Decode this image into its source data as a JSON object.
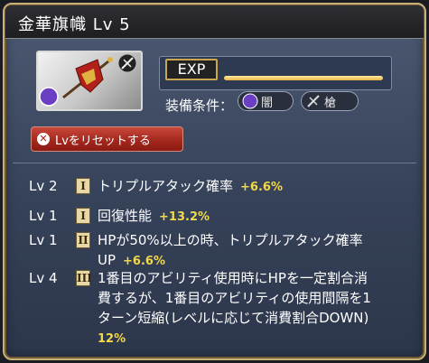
{
  "window": {
    "title": "金華旗幟 Lv 5"
  },
  "item": {
    "icon": "war-banner-icon",
    "element_badge": "dark-element-icon",
    "weapon_badge": "spear-icon"
  },
  "exp": {
    "label": "EXP",
    "progress": 1.0,
    "fill_color": "#f0c860"
  },
  "conditions": {
    "label": "装備条件：",
    "element": {
      "icon": "dark-element-icon",
      "text": "闇"
    },
    "weapon": {
      "icon": "spear-icon",
      "text": "槍"
    }
  },
  "reset_button": {
    "icon": "close-icon",
    "label": "Lvをリセットする"
  },
  "skills": [
    {
      "lv": "Lv 2",
      "tier": "I",
      "desc": "トリプルアタック確率",
      "value": "+6.6%"
    },
    {
      "lv": "Lv 1",
      "tier": "I",
      "desc": "回復性能",
      "value": "+13.2%"
    },
    {
      "lv": "Lv 1",
      "tier": "II",
      "desc_lines": [
        "HPが50%以上の時、トリプルアタック確率",
        "UP"
      ],
      "value": "+6.6%"
    },
    {
      "lv": "Lv 4",
      "tier": "III",
      "desc_lines": [
        "1番目のアビリティ使用時にHPを一定割合消",
        "費するが、1番目のアビリティの使用間隔を1",
        "ターン短縮(レベルに応じて消費割合DOWN)"
      ],
      "value": "12%"
    }
  ]
}
